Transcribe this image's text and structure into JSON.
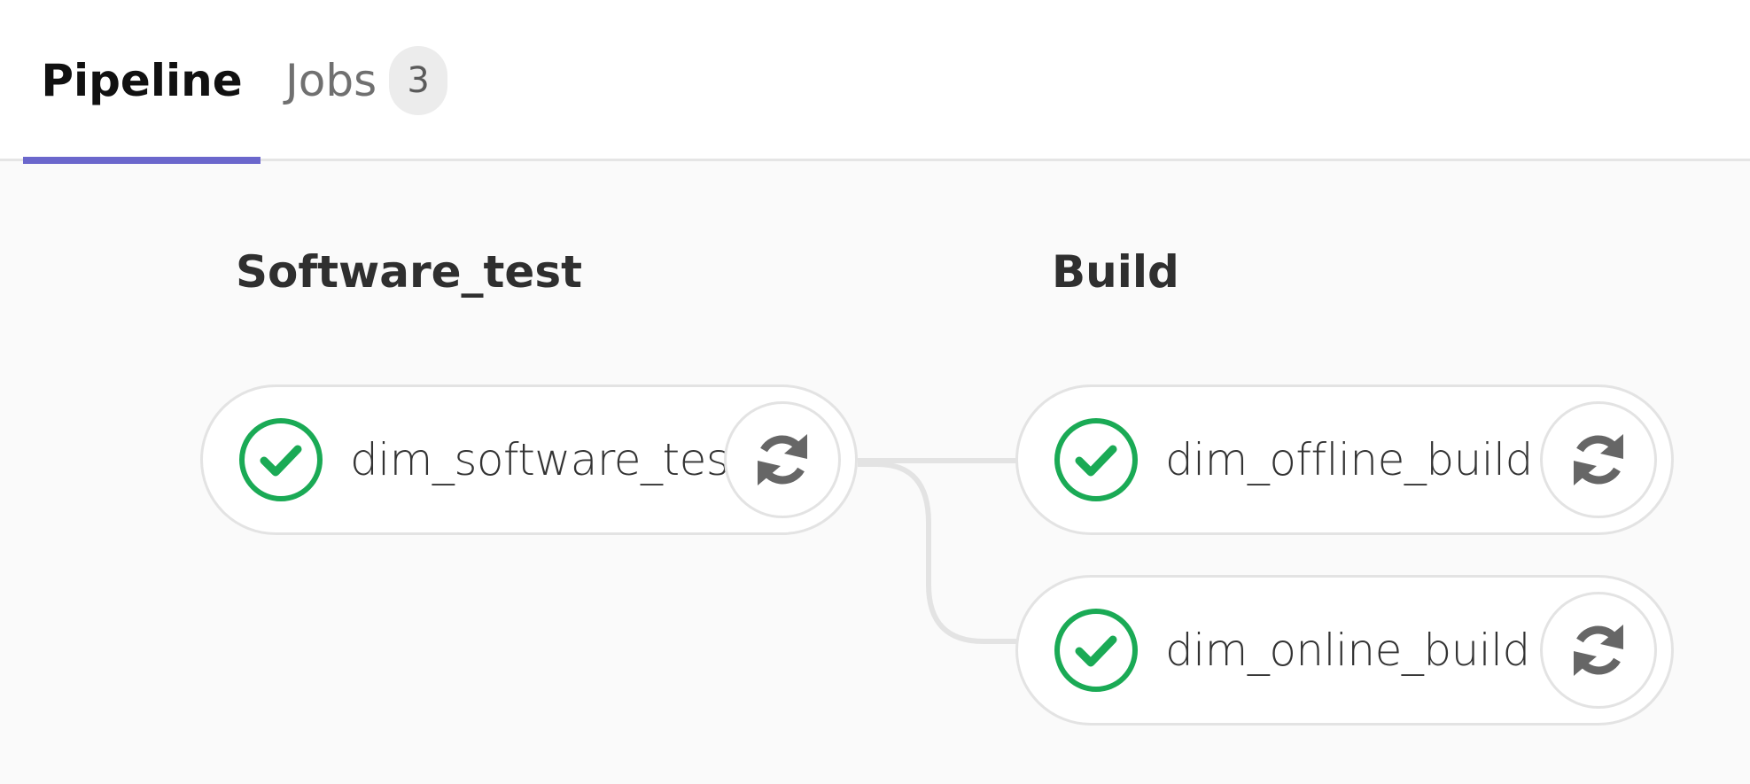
{
  "tabs": {
    "pipeline_label": "Pipeline",
    "jobs_label": "Jobs",
    "jobs_count": "3"
  },
  "stages": [
    {
      "title": "Software_test",
      "jobs": [
        {
          "name": "dim_software_test",
          "status": "success",
          "icon": "check-circle-icon"
        }
      ]
    },
    {
      "title": "Build",
      "jobs": [
        {
          "name": "dim_offline_build",
          "status": "success",
          "icon": "check-circle-icon"
        },
        {
          "name": "dim_online_build",
          "status": "success",
          "icon": "check-circle-icon"
        }
      ]
    }
  ],
  "colors": {
    "accent": "#6b67cc",
    "success": "#1aaa55",
    "background": "#fafafa",
    "icon_gray": "#666666"
  }
}
